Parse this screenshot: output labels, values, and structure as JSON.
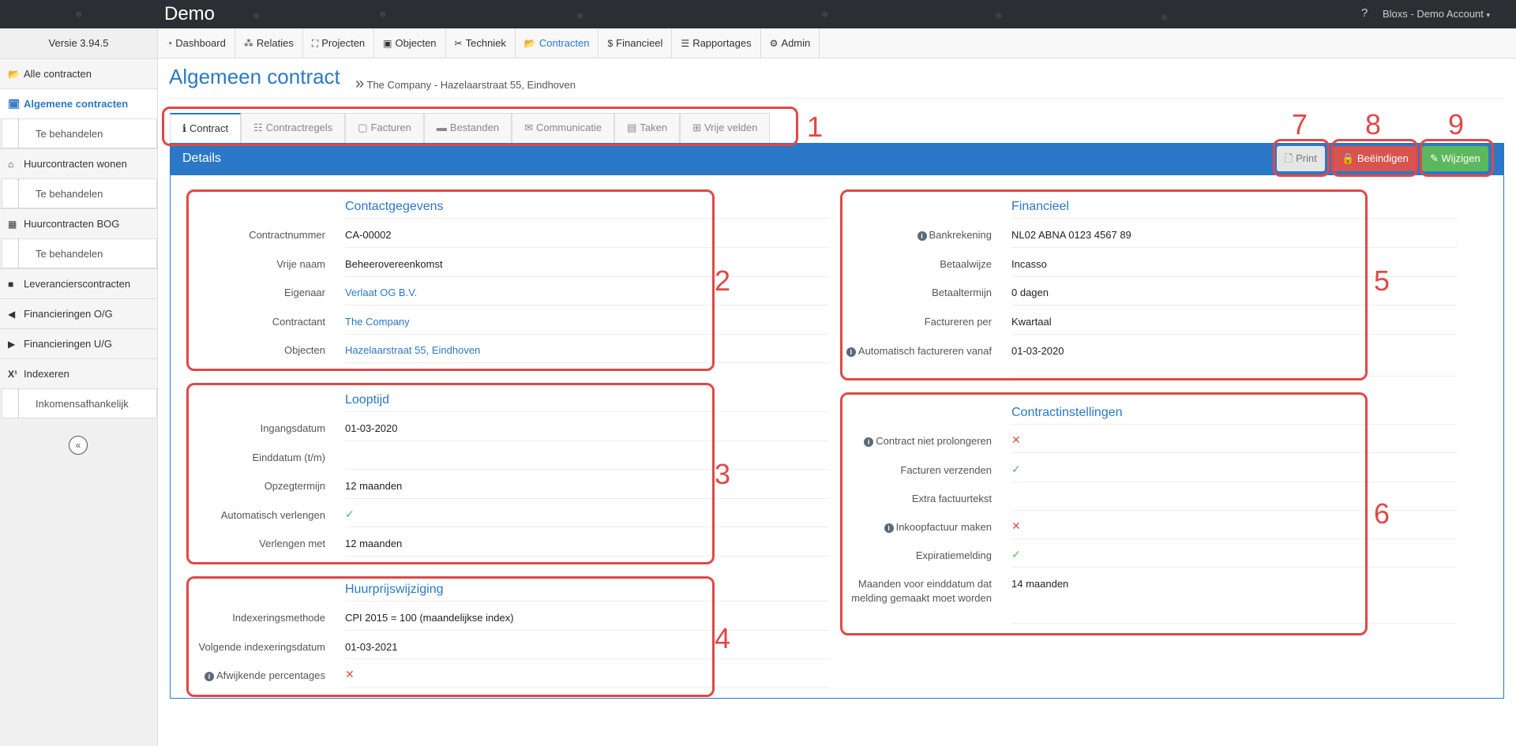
{
  "topbar": {
    "brand": "Demo",
    "help": "?",
    "account": "Bloxs - Demo Account"
  },
  "sidebar": {
    "version": "Versie 3.94.5",
    "items": [
      {
        "label": "Alle contracten",
        "icon": "folder-open-icon",
        "glyph": "📂"
      },
      {
        "label": "Algemene contracten",
        "icon": "calendar-icon",
        "glyph": "🗓"
      },
      {
        "label": "Te behandelen"
      },
      {
        "label": "Huurcontracten wonen",
        "icon": "home-icon",
        "glyph": "⌂"
      },
      {
        "label": "Te behandelen"
      },
      {
        "label": "Huurcontracten BOG",
        "icon": "building-icon",
        "glyph": "▦"
      },
      {
        "label": "Te behandelen"
      },
      {
        "label": "Leverancierscontracten",
        "icon": "briefcase-icon",
        "glyph": "■"
      },
      {
        "label": "Financieringen O/G",
        "icon": "circle-arrow-left-icon",
        "glyph": "◀"
      },
      {
        "label": "Financieringen U/G",
        "icon": "circle-arrow-right-icon",
        "glyph": "▶"
      },
      {
        "label": "Indexeren",
        "icon": "superscript-icon",
        "glyph": "X¹"
      },
      {
        "label": "Inkomensafhankelijk"
      }
    ],
    "collapse": "«"
  },
  "nav": [
    {
      "label": "Dashboard",
      "glyph": "◔"
    },
    {
      "label": "Relaties",
      "glyph": "⁂"
    },
    {
      "label": "Projecten",
      "glyph": "⛶"
    },
    {
      "label": "Objecten",
      "glyph": "▣"
    },
    {
      "label": "Techniek",
      "glyph": "✂"
    },
    {
      "label": "Contracten",
      "glyph": "📂"
    },
    {
      "label": "Financieel",
      "glyph": "$"
    },
    {
      "label": "Rapportages",
      "glyph": "☰"
    },
    {
      "label": "Admin",
      "glyph": "⚙"
    }
  ],
  "page": {
    "title": "Algemeen contract",
    "breadcrumb_sep": "»",
    "subtitle": "The Company - Hazelaarstraat 55, Eindhoven"
  },
  "tabs": [
    {
      "label": "Contract",
      "glyph": "ℹ"
    },
    {
      "label": "Contractregels",
      "glyph": "☷"
    },
    {
      "label": "Facturen",
      "glyph": "▢"
    },
    {
      "label": "Bestanden",
      "glyph": "▬"
    },
    {
      "label": "Communicatie",
      "glyph": "✉"
    },
    {
      "label": "Taken",
      "glyph": "▤"
    },
    {
      "label": "Vrije velden",
      "glyph": "⊞"
    }
  ],
  "panel": {
    "title": "Details",
    "print_label": "Print",
    "end_label": "Beëindigen",
    "edit_label": "Wijzigen"
  },
  "contact": {
    "title": "Contactgegevens",
    "rows": [
      {
        "label": "Contractnummer",
        "value": "CA-00002"
      },
      {
        "label": "Vrije naam",
        "value": "Beheerovereenkomst"
      },
      {
        "label": "Eigenaar",
        "value": "Verlaat OG B.V."
      },
      {
        "label": "Contractant",
        "value": "The Company"
      },
      {
        "label": "Objecten",
        "value": "Hazelaarstraat 55, Eindhoven"
      }
    ]
  },
  "looptijd": {
    "title": "Looptijd",
    "rows": [
      {
        "label": "Ingangsdatum",
        "value": "01-03-2020"
      },
      {
        "label": "Einddatum (t/m)",
        "value": ""
      },
      {
        "label": "Opzegtermijn",
        "value": "12 maanden"
      },
      {
        "label": "Automatisch verlengen",
        "value": "✓"
      },
      {
        "label": "Verlengen met",
        "value": "12 maanden"
      }
    ]
  },
  "huurprijs": {
    "title": "Huurprijswijziging",
    "rows": [
      {
        "label": "Indexeringsmethode",
        "value": "CPI 2015 = 100 (maandelijkse index)"
      },
      {
        "label": "Volgende indexeringsdatum",
        "value": "01-03-2021"
      },
      {
        "label": "Afwijkende percentages",
        "value": "✕"
      }
    ]
  },
  "financieel": {
    "title": "Financieel",
    "rows": [
      {
        "label": "Bankrekening",
        "value": "NL02 ABNA 0123 4567 89"
      },
      {
        "label": "Betaalwijze",
        "value": "Incasso"
      },
      {
        "label": "Betaaltermijn",
        "value": "0 dagen"
      },
      {
        "label": "Factureren per",
        "value": "Kwartaal"
      },
      {
        "label": "Automatisch factureren vanaf",
        "value": "01-03-2020"
      }
    ]
  },
  "instellingen": {
    "title": "Contractinstellingen",
    "rows": [
      {
        "label": "Contract niet prolongeren",
        "value": "✕"
      },
      {
        "label": "Facturen verzenden",
        "value": "✓"
      },
      {
        "label": "Extra factuurtekst",
        "value": ""
      },
      {
        "label": "Inkoopfactuur maken",
        "value": "✕"
      },
      {
        "label": "Expiratiemelding",
        "value": "✓"
      },
      {
        "label": "Maanden voor einddatum dat melding gemaakt moet worden",
        "value": "14 maanden"
      }
    ]
  },
  "annotations": [
    "1",
    "2",
    "3",
    "4",
    "5",
    "6",
    "7",
    "8",
    "9"
  ],
  "colors": {
    "accent": "#2a78c7",
    "danger": "#d9534f",
    "success": "#5cb85c",
    "annotation": "#e04848",
    "topbar": "#2b2f33"
  }
}
